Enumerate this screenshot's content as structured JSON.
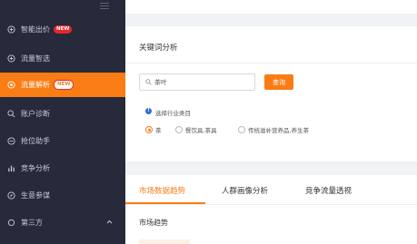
{
  "sidebar": {
    "items": [
      {
        "label": "智能出价",
        "badge": "NEW",
        "icon": "plus-circle-icon"
      },
      {
        "label": "流量智选",
        "badge": "",
        "icon": "plus-circle-icon"
      },
      {
        "label": "流量解析",
        "badge": "NEW",
        "icon": "target-icon",
        "active": true
      },
      {
        "label": "账户诊断",
        "badge": "",
        "icon": "magnifier-icon"
      },
      {
        "label": "抢位助手",
        "badge": "",
        "icon": "crosshair-icon"
      },
      {
        "label": "竞争分析",
        "badge": "",
        "icon": "bar-chart-icon"
      },
      {
        "label": "生意参谋",
        "badge": "",
        "icon": "compass-icon"
      },
      {
        "label": "第三方",
        "badge": "",
        "icon": "circle-icon"
      }
    ]
  },
  "keyword": {
    "title": "关键词分析",
    "search_value": "茶叶",
    "query_label": "查询",
    "industry_label": "选择行业类目",
    "options": [
      "茶",
      "餐饮具,茶具",
      "传统滋补营养品,养生茶"
    ]
  },
  "tabs": {
    "items": [
      "市场数据趋势",
      "人群画像分析",
      "竞争流量透视"
    ],
    "section_title": "市场趋势"
  },
  "colors": {
    "accent": "#fa7c14",
    "sidebar_bg": "#262a3b",
    "badge": "#e8262a"
  }
}
